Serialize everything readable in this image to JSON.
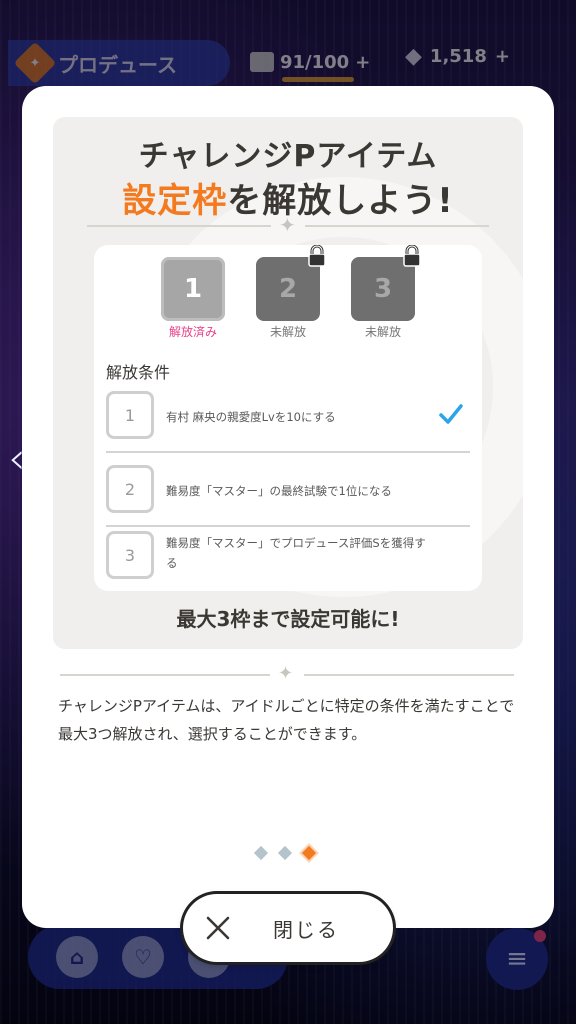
{
  "header": {
    "produce_label": "プロデュース",
    "stamina_value": "91/100",
    "gems_value": "1,518"
  },
  "bottom_nav": {
    "home_icon": "home-icon",
    "idol_icon": "idol-icon",
    "menu_icon": "menu-icon"
  },
  "modal": {
    "headline_line1": "チャレンジPアイテム",
    "headline_accent": "設定枠",
    "headline_rest": "を解放しよう!",
    "slots": [
      {
        "number": "1",
        "status": "解放済み",
        "locked": false
      },
      {
        "number": "2",
        "status": "未解放",
        "locked": true
      },
      {
        "number": "3",
        "status": "未解放",
        "locked": true
      }
    ],
    "conditions_title": "解放条件",
    "conditions": [
      {
        "number": "1",
        "text": "有村 麻央の親愛度Lvを10にする",
        "done": true
      },
      {
        "number": "2",
        "text": "難易度「マスター」の最終試験で1位になる",
        "done": false
      },
      {
        "number": "3",
        "text": "難易度「マスター」でプロデュース評価Sを獲得する",
        "done": false
      }
    ],
    "max_note": "最大3枠まで設定可能に!",
    "description": "チャレンジPアイテムは、アイドルごとに特定の条件を満たすことで最大3つ解放され、選択することができます。",
    "pagination": {
      "total": 3,
      "current": 3
    },
    "close_label": "閉じる"
  },
  "colors": {
    "accent_orange": "#f47a1f",
    "unlocked_pink": "#e8418a",
    "check_blue": "#2aa5e8"
  }
}
